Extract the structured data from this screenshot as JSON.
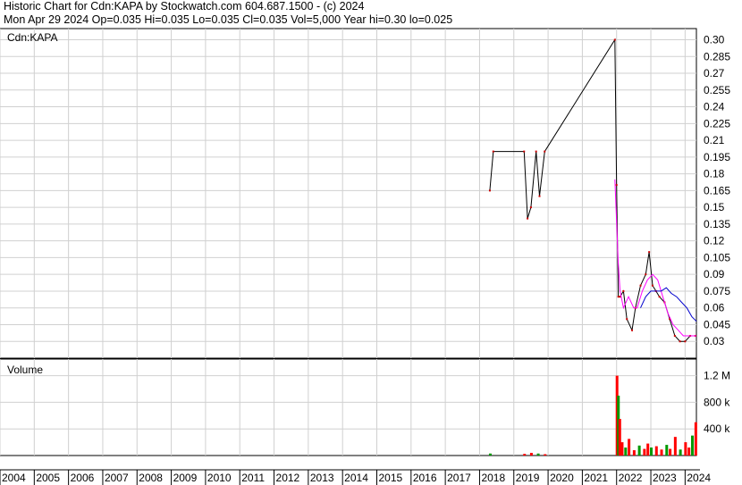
{
  "header": {
    "line1": "Historic Chart for Cdn:KAPA by Stockwatch.com 604.687.1500 - (c) 2024",
    "line2": "Mon Apr 29 2024   Op=0.035   Hi=0.035   Lo=0.035   Cl=0.035   Vol=5,000   Year hi=0.30   lo=0.025"
  },
  "colors": {
    "price": "#000000",
    "down": "#cc0000",
    "ma_short": "#ff00ff",
    "ma_long": "#0000cc",
    "volume_up": "#009900",
    "volume_down": "#ff0000",
    "grid": "#d0d0d0"
  },
  "chart_data": [
    {
      "type": "line",
      "title": "Cdn:KAPA",
      "grid": true,
      "x_range": [
        2004,
        2024.33
      ],
      "ylim": [
        0.015,
        0.31
      ],
      "y_ticks": [
        0.3,
        0.285,
        0.27,
        0.255,
        0.24,
        0.225,
        0.21,
        0.195,
        0.18,
        0.165,
        0.15,
        0.135,
        0.12,
        0.105,
        0.09,
        0.075,
        0.06,
        0.045,
        0.03
      ],
      "y_tick_labels": [
        "0.30",
        "0.285",
        "0.27",
        "0.255",
        "0.24",
        "0.225",
        "0.21",
        "0.195",
        "0.18",
        "0.165",
        "0.15",
        "0.135",
        "0.12",
        "0.105",
        "0.09",
        "0.075",
        "0.06",
        "0.045",
        "0.03"
      ],
      "series": [
        {
          "x": [
            2018.3,
            2018.4,
            2019.3,
            2019.4,
            2019.5,
            2019.65,
            2019.75,
            2019.9,
            2021.95,
            2022.0,
            2022.05,
            2022.1,
            2022.2,
            2022.3,
            2022.45,
            2022.55,
            2022.7,
            2022.85,
            2022.95,
            2023.05,
            2023.15,
            2023.25,
            2023.4,
            2023.55,
            2023.7,
            2023.85,
            2024.0,
            2024.15,
            2024.3
          ],
          "y": [
            0.165,
            0.2,
            0.2,
            0.14,
            0.15,
            0.2,
            0.16,
            0.2,
            0.3,
            0.17,
            0.07,
            0.07,
            0.075,
            0.05,
            0.04,
            0.06,
            0.08,
            0.09,
            0.11,
            0.08,
            0.075,
            0.07,
            0.065,
            0.05,
            0.035,
            0.03,
            0.03,
            0.035,
            0.035
          ]
        },
        {
          "x": [
            2021.95,
            2022.05,
            2022.1,
            2022.2,
            2022.35,
            2022.5,
            2022.6,
            2022.75,
            2022.9,
            2023.05,
            2023.2,
            2023.35,
            2023.5,
            2023.65,
            2023.8,
            2023.95,
            2024.1,
            2024.25,
            2024.33
          ],
          "y": [
            0.175,
            0.1,
            0.075,
            0.06,
            0.07,
            0.06,
            0.06,
            0.075,
            0.085,
            0.09,
            0.085,
            0.07,
            0.055,
            0.045,
            0.04,
            0.035,
            0.035,
            0.035,
            0.035
          ]
        },
        {
          "x": [
            2022.7,
            2022.85,
            2023.0,
            2023.15,
            2023.3,
            2023.45,
            2023.6,
            2023.75,
            2023.9,
            2024.05,
            2024.2,
            2024.33
          ],
          "y": [
            0.06,
            0.07,
            0.075,
            0.075,
            0.075,
            0.078,
            0.073,
            0.07,
            0.065,
            0.06,
            0.052,
            0.048
          ]
        }
      ]
    },
    {
      "type": "bar",
      "title": "Volume",
      "grid": true,
      "x_range": [
        2004,
        2024.33
      ],
      "ylim": [
        0,
        1450000
      ],
      "y_ticks": [
        400000,
        800000,
        1200000
      ],
      "y_tick_labels": [
        "400 k",
        "800 k",
        "1.2 M"
      ],
      "x_tick_labels": [
        "2004",
        "2005",
        "2006",
        "2007",
        "2008",
        "2009",
        "2010",
        "2011",
        "2012",
        "2013",
        "2014",
        "2015",
        "2016",
        "2017",
        "2018",
        "2019",
        "2020",
        "2021",
        "2022",
        "2023",
        "2024"
      ],
      "x": [
        2018.3,
        2019.3,
        2019.5,
        2019.7,
        2019.9,
        2022.0,
        2022.04,
        2022.08,
        2022.15,
        2022.25,
        2022.35,
        2022.5,
        2022.65,
        2022.8,
        2022.9,
        2023.0,
        2023.15,
        2023.3,
        2023.45,
        2023.55,
        2023.7,
        2023.85,
        2024.0,
        2024.1,
        2024.2,
        2024.3
      ],
      "values": [
        30000,
        25000,
        40000,
        30000,
        20000,
        1200000,
        900000,
        550000,
        200000,
        120000,
        250000,
        80000,
        150000,
        100000,
        180000,
        120000,
        140000,
        90000,
        160000,
        100000,
        280000,
        90000,
        200000,
        120000,
        300000,
        500000
      ]
    }
  ]
}
